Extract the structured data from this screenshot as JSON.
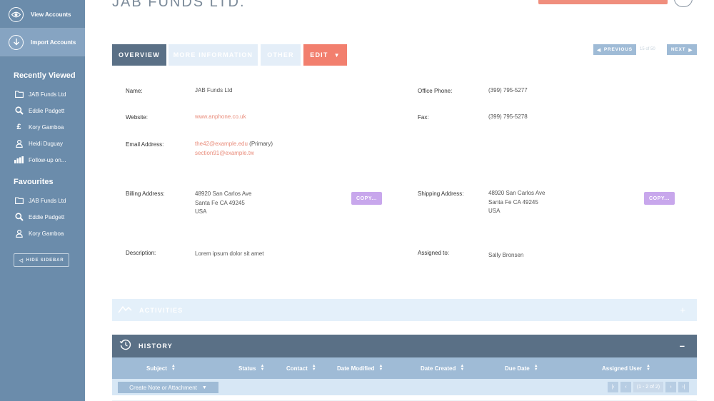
{
  "sidebar": {
    "view_accounts": "View Accounts",
    "import_accounts": "Import Accounts",
    "recently_viewed_heading": "Recently Viewed",
    "recent": [
      {
        "label": "JAB Funds Ltd",
        "icon": "folder-icon"
      },
      {
        "label": "Eddie Padgett",
        "icon": "search-icon"
      },
      {
        "label": "Kory Gamboa",
        "icon": "pound-icon"
      },
      {
        "label": "Heidi Duguay",
        "icon": "person-icon"
      },
      {
        "label": "Follow-up on...",
        "icon": "bar-chart-icon"
      }
    ],
    "favourites_heading": "Favourites",
    "favourites": [
      {
        "label": "JAB Funds Ltd",
        "icon": "folder-icon"
      },
      {
        "label": "Eddie Padgett",
        "icon": "search-icon"
      },
      {
        "label": "Kory Gamboa",
        "icon": "person-icon"
      }
    ],
    "hide_sidebar": "HIDE SIDEBAR"
  },
  "header": {
    "title": "JAB FUNDS LTD."
  },
  "tabs": {
    "overview": "OVERVIEW",
    "more_information": "MORE INFORMATION",
    "other": "OTHER",
    "edit": "EDIT"
  },
  "pager": {
    "previous": "PREVIOUS",
    "count": "15 of 50",
    "next": "NEXT"
  },
  "fields": {
    "name_label": "Name:",
    "name_value": "JAB Funds Ltd",
    "office_phone_label": "Office Phone:",
    "office_phone_value": "(399) 795-5277",
    "website_label": "Website:",
    "website_value": "www.anphone.co.uk",
    "fax_label": "Fax:",
    "fax_value": "(399) 795-5278",
    "email_label": "Email Address:",
    "email_primary": "the42@example.edu",
    "email_primary_tag": " (Primary)",
    "email_secondary": "section91@example.tw",
    "billing_label": "Billing Address:",
    "billing_line1": "48920 San Carlos Ave",
    "billing_line2": "Santa Fe CA 49245",
    "billing_line3": "USA",
    "shipping_label": "Shipping Address:",
    "shipping_line1": "48920 San Carlos Ave",
    "shipping_line2": "Santa Fe CA 49245",
    "shipping_line3": "USA",
    "copy_label": "COPY...",
    "description_label": "Description:",
    "description_value": "Lorem ipsum dolor sit amet",
    "assigned_label": "Assigned to:",
    "assigned_value": "Sally Bronsen"
  },
  "activities": {
    "title": "ACTIVITIES",
    "expand": "+"
  },
  "history": {
    "title": "HISTORY",
    "collapse": "–",
    "columns": [
      "Subject",
      "Status",
      "Contact",
      "Date Modified",
      "Date Created",
      "Due Date",
      "Assigned User"
    ],
    "create_note": "Create Note or Attachment",
    "page_info": "(1 - 2 of 2)"
  },
  "colors": {
    "sidebar": "#6b8cab",
    "tab_active": "#5a7086",
    "edit_accent": "#f27f6e",
    "link": "#e98c7b",
    "copy_button": "#c8a7ec"
  }
}
